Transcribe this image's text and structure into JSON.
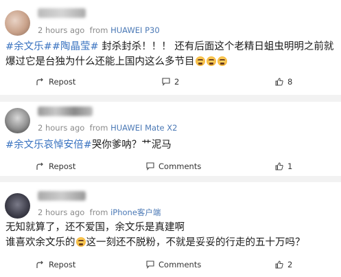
{
  "posts": [
    {
      "meta": {
        "time": "2 hours ago",
        "from_label": "from",
        "source": "HUAWEI P30"
      },
      "content": {
        "tag1": "#余文乐#",
        "tag2": "#陶晶莹#",
        "line1_text": " 封杀封杀！！！ 还有后面这个老精日蛆虫明明之前就",
        "line2_text": "爆过它是台独为什么还能上国内这么多节目"
      },
      "actions": {
        "repost": "Repost",
        "comments": "2",
        "likes": "8"
      }
    },
    {
      "meta": {
        "time": "2 hours ago",
        "from_label": "from",
        "source": "HUAWEI Mate X2"
      },
      "content": {
        "tag1": "#余文乐哀悼安倍#",
        "line1_text": "哭你爹呐？艹泥马"
      },
      "actions": {
        "repost": "Repost",
        "comments": "Comments",
        "likes": "1"
      }
    },
    {
      "meta": {
        "time": "2 hours ago",
        "from_label": "from",
        "source": "iPhone客户端"
      },
      "content": {
        "line1_text": "无知就算了，还不爱国，余文乐是真建啊",
        "line2_pre": "谁喜欢余文乐的",
        "line2_post": "这一刻还不脱粉，不就是妥妥的行走的五十万吗？"
      },
      "actions": {
        "repost": "Repost",
        "comments": "Comments",
        "likes": "2"
      }
    }
  ],
  "colors": {
    "link": "#3a73c0",
    "source": "#4a78b5",
    "meta": "#8a8a8a",
    "separator": "#f2f2f2"
  },
  "icons": {
    "repost": "repost-icon",
    "comment": "comment-icon",
    "like": "thumbs-up-icon"
  }
}
